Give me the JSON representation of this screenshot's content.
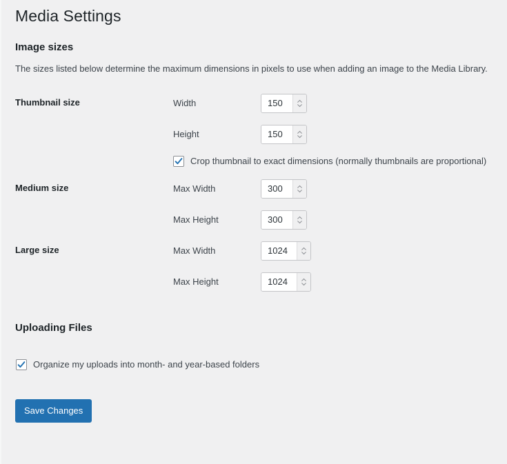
{
  "page": {
    "title": "Media Settings"
  },
  "image_sizes": {
    "heading": "Image sizes",
    "description": "The sizes listed below determine the maximum dimensions in pixels to use when adding an image to the Media Library.",
    "rows": [
      {
        "title": "Thumbnail size",
        "fields": [
          {
            "label": "Width",
            "value": "150"
          },
          {
            "label": "Height",
            "value": "150"
          }
        ],
        "checkbox": {
          "label": "Crop thumbnail to exact dimensions (normally thumbnails are proportional)",
          "checked": true
        }
      },
      {
        "title": "Medium size",
        "fields": [
          {
            "label": "Max Width",
            "value": "300"
          },
          {
            "label": "Max Height",
            "value": "300"
          }
        ]
      },
      {
        "title": "Large size",
        "fields": [
          {
            "label": "Max Width",
            "value": "1024"
          },
          {
            "label": "Max Height",
            "value": "1024"
          }
        ]
      }
    ]
  },
  "uploading_files": {
    "heading": "Uploading Files",
    "checkbox": {
      "label": "Organize my uploads into month- and year-based folders",
      "checked": true
    }
  },
  "submit": {
    "save_label": "Save Changes"
  },
  "colors": {
    "page_background": "#f0f0f1",
    "primary_button": "#2271b1",
    "heading_text": "#1d2327",
    "body_text": "#3c434a",
    "checkbox_check": "#2271b1",
    "input_border": "#c3c4c7"
  }
}
